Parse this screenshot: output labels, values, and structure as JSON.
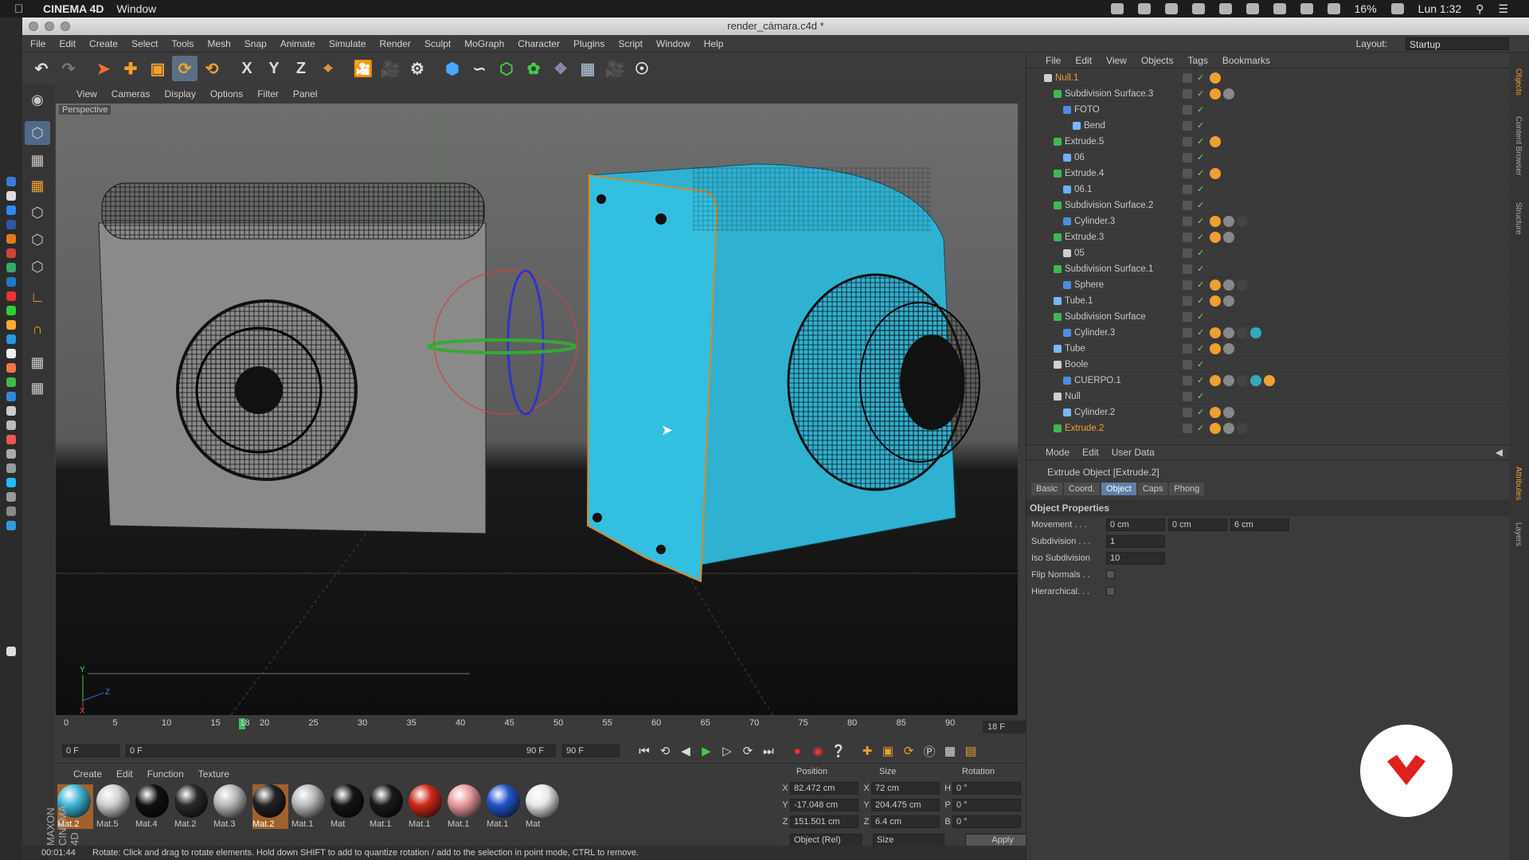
{
  "mac": {
    "app": "CINEMA 4D",
    "menu_window": "Window",
    "battery": "16%",
    "clock": "Lun 1:32"
  },
  "window": {
    "title": "render_cámara.c4d *"
  },
  "menu": [
    "File",
    "Edit",
    "Create",
    "Select",
    "Tools",
    "Mesh",
    "Snap",
    "Animate",
    "Simulate",
    "Render",
    "Sculpt",
    "MoGraph",
    "Character",
    "Plugins",
    "Script",
    "Window",
    "Help"
  ],
  "layout": {
    "label": "Layout:",
    "value": "Startup"
  },
  "toolbar": {
    "x": "X",
    "y": "Y",
    "z": "Z"
  },
  "viewport": {
    "menu": [
      "View",
      "Cameras",
      "Display",
      "Options",
      "Filter",
      "Panel"
    ],
    "label": "Perspective",
    "axis_y": "Y",
    "axis_z": "Z",
    "axis_x": "X"
  },
  "timeline": {
    "ticks": [
      "0",
      "5",
      "10",
      "15",
      "18",
      "20",
      "25",
      "30",
      "35",
      "40",
      "45",
      "50",
      "55",
      "60",
      "65",
      "70",
      "75",
      "80",
      "85",
      "90"
    ],
    "current": "18 F"
  },
  "transport": {
    "start": "0 F",
    "range_start": "0 F",
    "range_end": "90 F",
    "end": "90 F"
  },
  "materials": {
    "menu": [
      "Create",
      "Edit",
      "Function",
      "Texture"
    ],
    "items": [
      {
        "name": "Mat.2",
        "color": "#3fb5d8"
      },
      {
        "name": "Mat.5",
        "color": "#d0d0d0"
      },
      {
        "name": "Mat.4",
        "color": "#111111"
      },
      {
        "name": "Mat.2",
        "color": "#2a2a2a"
      },
      {
        "name": "Mat.3",
        "color": "#b8b8b8"
      },
      {
        "name": "Mat.2",
        "color": "#222222"
      },
      {
        "name": "Mat.1",
        "color": "#bbbbbb"
      },
      {
        "name": "Mat",
        "color": "#151515"
      },
      {
        "name": "Mat.1",
        "color": "#1a1a1a"
      },
      {
        "name": "Mat.1",
        "color": "#cc2a1a"
      },
      {
        "name": "Mat.1",
        "color": "#e89aa0"
      },
      {
        "name": "Mat.1",
        "color": "#2255c8"
      },
      {
        "name": "Mat",
        "color": "#e8e8e8"
      }
    ]
  },
  "coords": {
    "headers": [
      "Position",
      "Size",
      "Rotation"
    ],
    "rows": [
      {
        "axis": "X",
        "pos": "82.472 cm",
        "saxis": "X",
        "size": "72 cm",
        "raxis": "H",
        "rot": "0 °"
      },
      {
        "axis": "Y",
        "pos": "-17.048 cm",
        "saxis": "Y",
        "size": "204.475 cm",
        "raxis": "P",
        "rot": "0 °"
      },
      {
        "axis": "Z",
        "pos": "151.501 cm",
        "saxis": "Z",
        "size": "6.4 cm",
        "raxis": "B",
        "rot": "0 °"
      }
    ],
    "mode": "Object (Rel)",
    "size_mode": "Size",
    "apply": "Apply"
  },
  "status": {
    "time": "00:01:44",
    "message": "Rotate: Click and drag to rotate elements. Hold down SHIFT to add to quantize rotation / add to the selection in point mode, CTRL to remove."
  },
  "objects": {
    "menu": [
      "File",
      "Edit",
      "View",
      "Objects",
      "Tags",
      "Bookmarks"
    ],
    "items": [
      {
        "name": "Null.1",
        "indent": 0,
        "type": "null",
        "hl": true
      },
      {
        "name": "Subdivision Surface.3",
        "indent": 1,
        "type": "sds"
      },
      {
        "name": "FOTO",
        "indent": 2,
        "type": "poly"
      },
      {
        "name": "Bend",
        "indent": 3,
        "type": "deform"
      },
      {
        "name": "Extrude.5",
        "indent": 1,
        "type": "sds"
      },
      {
        "name": "06",
        "indent": 2,
        "type": "spline"
      },
      {
        "name": "Extrude.4",
        "indent": 1,
        "type": "sds"
      },
      {
        "name": "06.1",
        "indent": 2,
        "type": "spline"
      },
      {
        "name": "Subdivision Surface.2",
        "indent": 1,
        "type": "sds"
      },
      {
        "name": "Cylinder.3",
        "indent": 2,
        "type": "poly"
      },
      {
        "name": "Extrude.3",
        "indent": 1,
        "type": "sds"
      },
      {
        "name": "05",
        "indent": 2,
        "type": "null"
      },
      {
        "name": "Subdivision Surface.1",
        "indent": 1,
        "type": "sds"
      },
      {
        "name": "Sphere",
        "indent": 2,
        "type": "poly"
      },
      {
        "name": "Tube.1",
        "indent": 1,
        "type": "deform"
      },
      {
        "name": "Subdivision Surface",
        "indent": 1,
        "type": "sds"
      },
      {
        "name": "Cylinder.3",
        "indent": 2,
        "type": "poly"
      },
      {
        "name": "Tube",
        "indent": 1,
        "type": "deform"
      },
      {
        "name": "Boole",
        "indent": 1,
        "type": "null"
      },
      {
        "name": "CUERPO.1",
        "indent": 2,
        "type": "poly"
      },
      {
        "name": "Null",
        "indent": 1,
        "type": "null"
      },
      {
        "name": "Cylinder.2",
        "indent": 2,
        "type": "deform"
      },
      {
        "name": "Extrude.2",
        "indent": 1,
        "type": "sds",
        "hl": true
      }
    ]
  },
  "attributes": {
    "menu": [
      "Mode",
      "Edit",
      "User Data"
    ],
    "title": "Extrude Object [Extrude.2]",
    "tabs": [
      "Basic",
      "Coord.",
      "Object",
      "Caps",
      "Phong"
    ],
    "section": "Object Properties",
    "movement_label": "Movement . . .",
    "movement": [
      "0 cm",
      "0 cm",
      "6 cm"
    ],
    "subdivision_label": "Subdivision . . .",
    "subdivision": "1",
    "iso_label": "Iso Subdivision",
    "iso": "10",
    "flip_label": "Flip Normals . .",
    "hier_label": "Hierarchical. . ."
  },
  "sidetabs": [
    "Objects",
    "Content Browser",
    "Structure",
    "Attributes",
    "Layers"
  ],
  "brand": "MAXON CINEMA 4D"
}
